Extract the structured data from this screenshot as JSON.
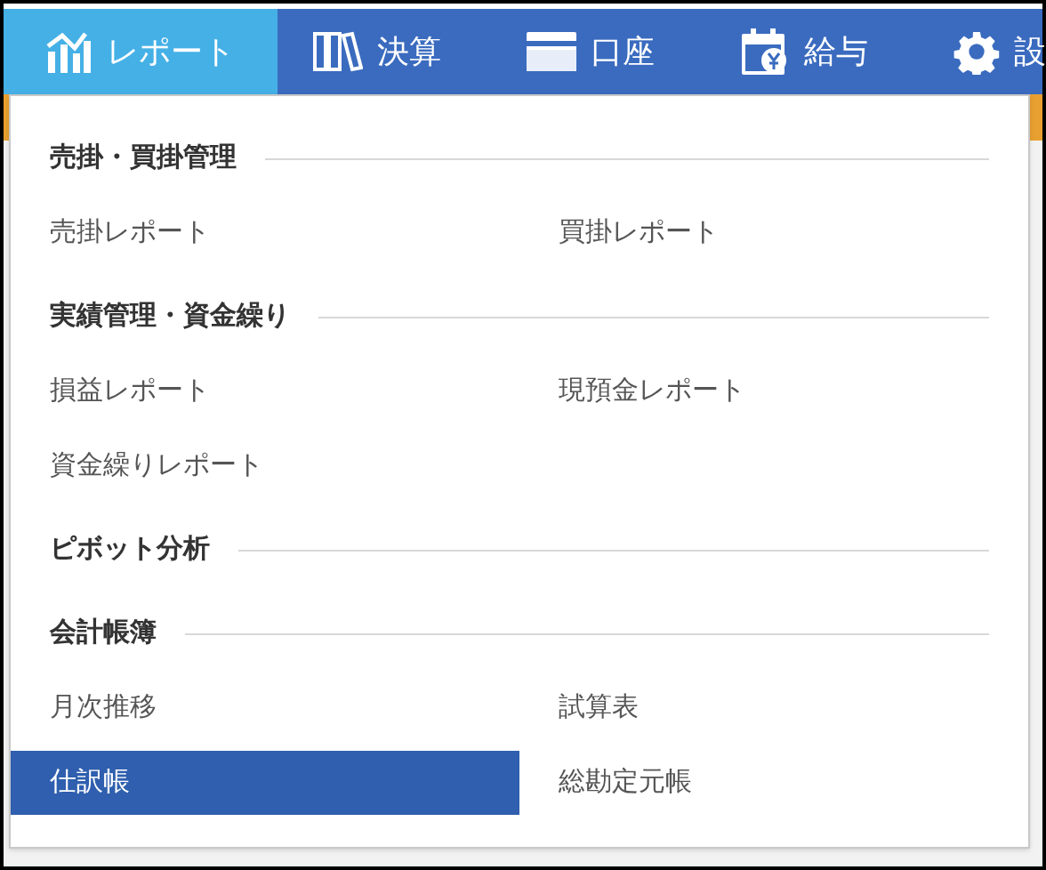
{
  "nav": [
    {
      "label": "レポート",
      "kind": "chart",
      "selected": true
    },
    {
      "label": "決算",
      "kind": "books",
      "selected": false
    },
    {
      "label": "口座",
      "kind": "card",
      "selected": false
    },
    {
      "label": "給与",
      "kind": "calendar",
      "selected": false
    },
    {
      "label": "設",
      "kind": "gear",
      "selected": false
    }
  ],
  "menu": {
    "sections": [
      {
        "title": "売掛・買掛管理",
        "items": [
          {
            "label": "売掛レポート",
            "selected": false
          },
          {
            "label": "買掛レポート",
            "selected": false
          }
        ]
      },
      {
        "title": "実績管理・資金繰り",
        "items": [
          {
            "label": "損益レポート",
            "selected": false
          },
          {
            "label": "現預金レポート",
            "selected": false
          },
          {
            "label": "資金繰りレポート",
            "selected": false
          }
        ]
      },
      {
        "title": "ピボット分析"
      },
      {
        "title": "会計帳簿",
        "items": [
          {
            "label": "月次推移",
            "selected": false
          },
          {
            "label": "試算表",
            "selected": false
          },
          {
            "label": "仕訳帳",
            "selected": true
          },
          {
            "label": "総勘定元帳",
            "selected": false
          }
        ]
      }
    ]
  }
}
